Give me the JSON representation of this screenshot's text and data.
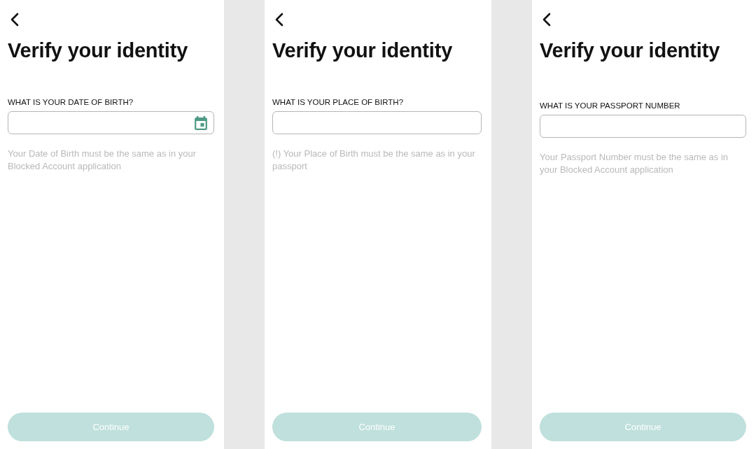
{
  "screens": [
    {
      "title": "Verify your identity",
      "field": {
        "label": "WHAT IS YOUR DATE OF BIRTH?",
        "kind": "date"
      },
      "hint": "Your Date of Birth must be the same as in your Blocked Account application",
      "button": {
        "label": "Continue",
        "disabled": true
      }
    },
    {
      "title": "Verify your identity",
      "field": {
        "label": "WHAT IS YOUR PLACE OF BIRTH?",
        "kind": "text"
      },
      "hint": "(!) Your Place of Birth must be the same as in your passport",
      "button": {
        "label": "Continue",
        "disabled": true
      }
    },
    {
      "title": "Verify your identity",
      "field": {
        "label": "WHAT IS YOUR PASSPORT NUMBER",
        "kind": "text"
      },
      "hint": "Your Passport Number must be the same as in your Blocked Account application",
      "button": {
        "label": "Continue",
        "disabled": true
      }
    }
  ]
}
